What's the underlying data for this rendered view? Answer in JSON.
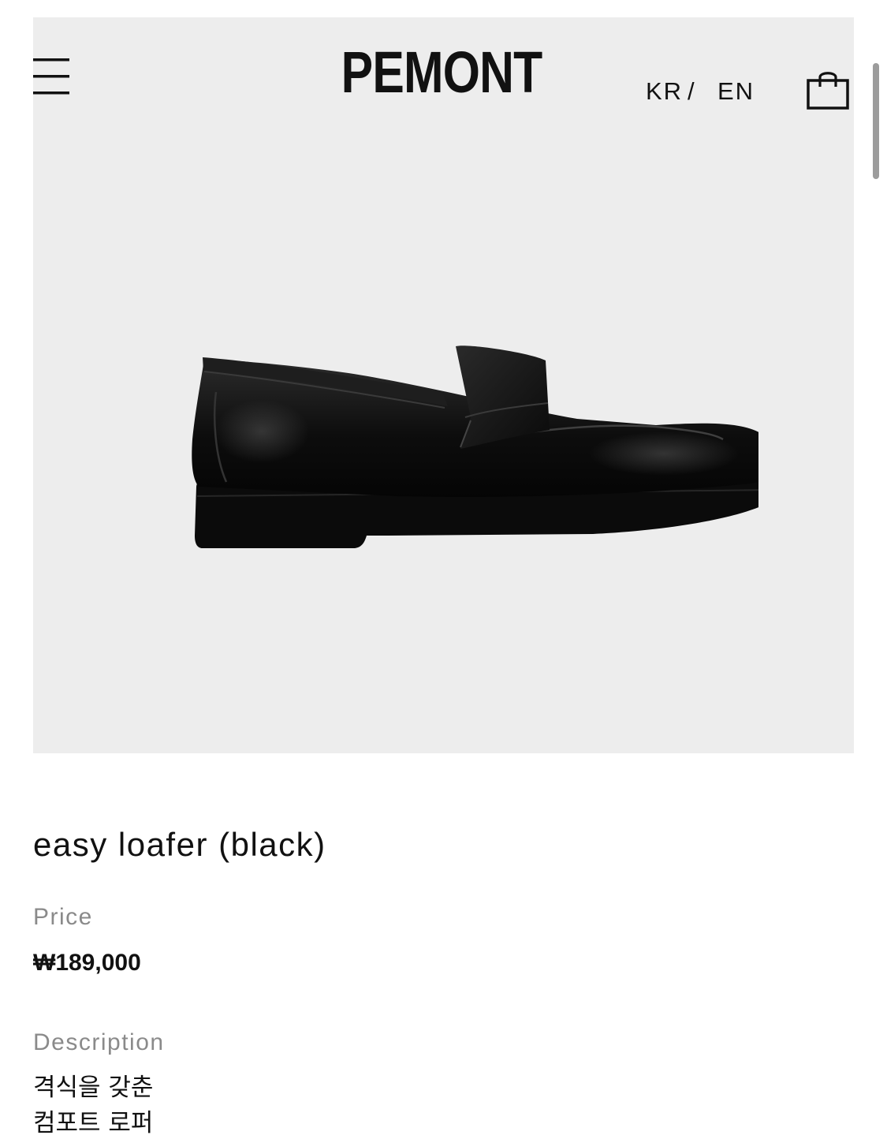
{
  "header": {
    "brand": "PEMONT",
    "lang_kr": "KR",
    "lang_separator": "/",
    "lang_en": "EN",
    "menu_icon": "hamburger-menu-icon",
    "cart_icon": "shopping-bag-icon"
  },
  "hero": {
    "background_color": "#ededed",
    "image": "black penny loafer product photo"
  },
  "product": {
    "title": "easy loafer (black)",
    "price_label": "Price",
    "price": "₩189,000",
    "description_label": "Description",
    "description_lines": [
      "격식을 갖춘",
      "컴포트 로퍼"
    ]
  },
  "colors": {
    "text": "#111111",
    "muted_label": "#8a8a8a",
    "hero_bg": "#ededed",
    "scrollbar": "#9c9c9c"
  }
}
